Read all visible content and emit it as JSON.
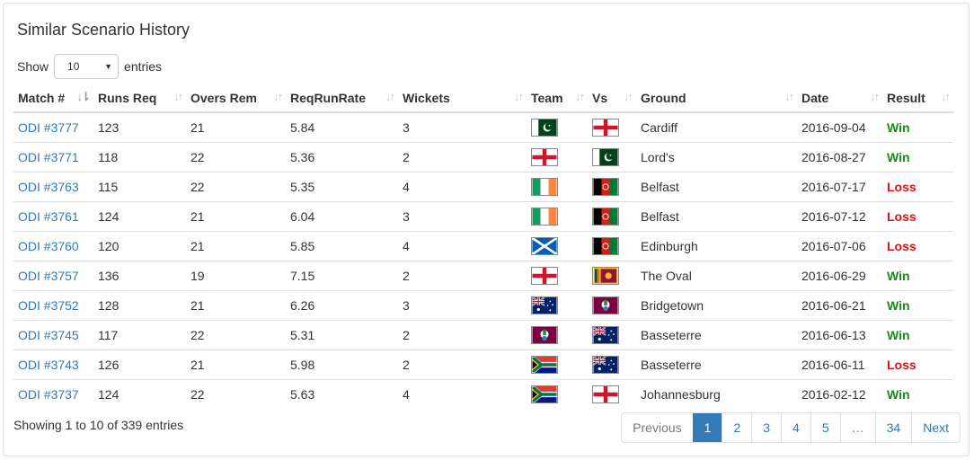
{
  "title": "Similar Scenario History",
  "length": {
    "show": "Show",
    "value": "10",
    "entries": "entries"
  },
  "columns": [
    "Match #",
    "Runs Req",
    "Overs Rem",
    "ReqRunRate",
    "Wickets",
    "Team",
    "Vs",
    "Ground",
    "Date",
    "Result"
  ],
  "rows": [
    {
      "match": "ODI #3777",
      "runs": "123",
      "overs": "21",
      "rrr": "5.84",
      "wkts": "3",
      "team": "pakistan",
      "vs": "england",
      "ground": "Cardiff",
      "date": "2016-09-04",
      "result": "Win"
    },
    {
      "match": "ODI #3771",
      "runs": "118",
      "overs": "22",
      "rrr": "5.36",
      "wkts": "2",
      "team": "england",
      "vs": "pakistan",
      "ground": "Lord's",
      "date": "2016-08-27",
      "result": "Win"
    },
    {
      "match": "ODI #3763",
      "runs": "115",
      "overs": "22",
      "rrr": "5.35",
      "wkts": "4",
      "team": "ireland",
      "vs": "afghanistan",
      "ground": "Belfast",
      "date": "2016-07-17",
      "result": "Loss"
    },
    {
      "match": "ODI #3761",
      "runs": "124",
      "overs": "21",
      "rrr": "6.04",
      "wkts": "3",
      "team": "ireland",
      "vs": "afghanistan",
      "ground": "Belfast",
      "date": "2016-07-12",
      "result": "Loss"
    },
    {
      "match": "ODI #3760",
      "runs": "120",
      "overs": "21",
      "rrr": "5.85",
      "wkts": "4",
      "team": "scotland",
      "vs": "afghanistan",
      "ground": "Edinburgh",
      "date": "2016-07-06",
      "result": "Loss"
    },
    {
      "match": "ODI #3757",
      "runs": "136",
      "overs": "19",
      "rrr": "7.15",
      "wkts": "2",
      "team": "england",
      "vs": "sri-lanka",
      "ground": "The Oval",
      "date": "2016-06-29",
      "result": "Win"
    },
    {
      "match": "ODI #3752",
      "runs": "128",
      "overs": "21",
      "rrr": "6.26",
      "wkts": "3",
      "team": "australia",
      "vs": "west-indies",
      "ground": "Bridgetown",
      "date": "2016-06-21",
      "result": "Win"
    },
    {
      "match": "ODI #3745",
      "runs": "117",
      "overs": "22",
      "rrr": "5.31",
      "wkts": "2",
      "team": "west-indies",
      "vs": "australia",
      "ground": "Basseterre",
      "date": "2016-06-13",
      "result": "Win"
    },
    {
      "match": "ODI #3743",
      "runs": "126",
      "overs": "21",
      "rrr": "5.98",
      "wkts": "2",
      "team": "south-africa",
      "vs": "australia",
      "ground": "Basseterre",
      "date": "2016-06-11",
      "result": "Loss"
    },
    {
      "match": "ODI #3737",
      "runs": "124",
      "overs": "22",
      "rrr": "5.63",
      "wkts": "4",
      "team": "south-africa",
      "vs": "england",
      "ground": "Johannesburg",
      "date": "2016-02-12",
      "result": "Win"
    }
  ],
  "info": "Showing 1 to 10 of 339 entries",
  "pagination": [
    "Previous",
    "1",
    "2",
    "3",
    "4",
    "5",
    "…",
    "34",
    "Next"
  ],
  "colors": {
    "link": "#337ab7",
    "win": "#1a8a1a",
    "loss": "#e01010",
    "active_page": "#337ab7"
  }
}
